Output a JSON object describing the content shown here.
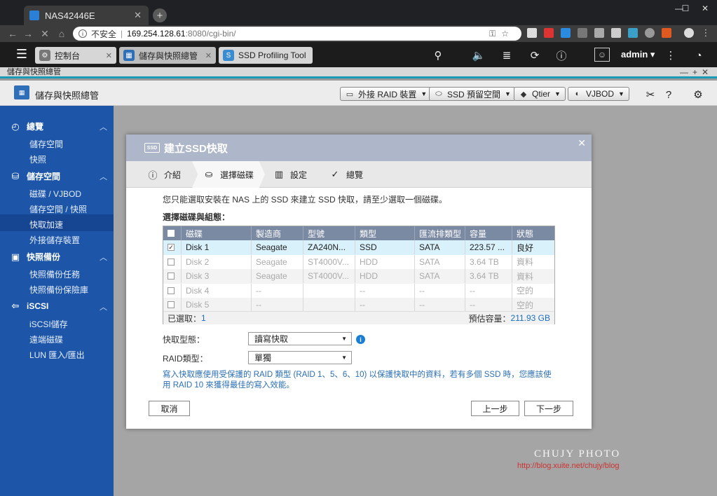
{
  "browser": {
    "tab_title": "NAS42446E",
    "security": "不安全",
    "url_host": "169.254.128.61",
    "url_rest": ":8080/cgi-bin/"
  },
  "qts": {
    "tabs": [
      "控制台",
      "儲存與快照總管",
      "SSD Profiling Tool"
    ],
    "user": "admin"
  },
  "window": {
    "title": "儲存與快照總管"
  },
  "app": {
    "title": "儲存與快照總管",
    "buttons": [
      "外接 RAID 裝置",
      "SSD 預留空間",
      "Qtier",
      "VJBOD"
    ]
  },
  "sidebar": {
    "groups": [
      {
        "label": "總覽",
        "items": [
          "儲存空間",
          "快照"
        ]
      },
      {
        "label": "儲存空間",
        "items": [
          "磁碟 / VJBOD",
          "儲存空間 / 快照",
          "快取加速",
          "外接儲存裝置"
        ]
      },
      {
        "label": "快照備份",
        "items": [
          "快照備份任務",
          "快照備份保險庫"
        ]
      },
      {
        "label": "iSCSI",
        "items": [
          "iSCSI儲存",
          "遠端磁碟",
          "LUN 匯入/匯出"
        ]
      }
    ],
    "selected": "快取加速"
  },
  "dialog": {
    "title": "建立SSD快取",
    "steps": [
      "介紹",
      "選擇磁碟",
      "設定",
      "總覽"
    ],
    "intro": "您只能選取安裝在 NAS 上的 SSD 來建立 SSD 快取，請至少選取一個磁碟。",
    "table_label": "選擇磁碟與組態：",
    "columns": [
      "磁碟",
      "製造商",
      "型號",
      "類型",
      "匯流排類型",
      "容量",
      "狀態"
    ],
    "rows": [
      [
        "Disk 1",
        "Seagate",
        "ZA240N...",
        "SSD",
        "SATA",
        "223.57 ...",
        "良好"
      ],
      [
        "Disk 2",
        "Seagate",
        "ST4000V...",
        "HDD",
        "SATA",
        "3.64 TB",
        "資料"
      ],
      [
        "Disk 3",
        "Seagate",
        "ST4000V...",
        "HDD",
        "SATA",
        "3.64 TB",
        "資料"
      ],
      [
        "Disk 4",
        "--",
        "",
        "--",
        "--",
        "--",
        "空的"
      ],
      [
        "Disk 5",
        "--",
        "",
        "--",
        "--",
        "--",
        "空的"
      ]
    ],
    "selected_label": "已選取：",
    "selected_count": "1",
    "capacity_label": "預估容量：",
    "capacity_value": "211.93 GB",
    "cache_type_label": "快取型態：",
    "cache_type_value": "讀寫快取",
    "raid_label": "RAID類型：",
    "raid_value": "單獨",
    "note": "寫入快取應使用受保護的 RAID 類型 (RAID 1、5、6、10) 以保護快取中的資料，若有多個 SSD 時，您應該使用 RAID 10 來獲得最佳的寫入效能。",
    "cancel": "取消",
    "back": "上一步",
    "next": "下一步"
  },
  "watermark": {
    "line1": "CHUJY PHOTO",
    "line2": "http://blog.xuite.net/chujy/blog"
  }
}
